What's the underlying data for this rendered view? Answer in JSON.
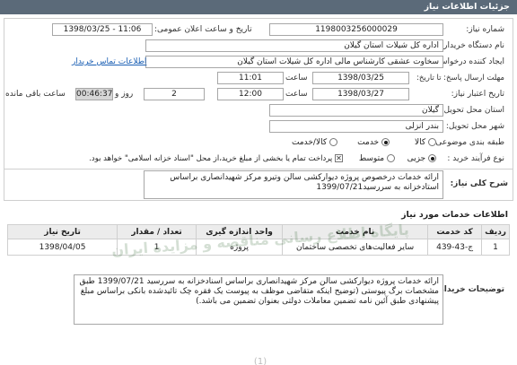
{
  "header": {
    "title": "جزئیات اطلاعات نیاز"
  },
  "fields": {
    "need_number_label": "شماره نیاز:",
    "need_number": "1198003256000029",
    "announce_label": "تاریخ و ساعت اعلان عمومی:",
    "announce_value": "1398/03/25 - 11:06",
    "buyer_label": "نام دستگاه خریدار:",
    "buyer_value": "اداره کل شیلات استان گیلان",
    "creator_label": "ایجاد کننده درخواست:",
    "creator_value": "سخاوت  عشقی  کارشناس مالی  اداره کل شیلات استان گیلان",
    "contact_link": "اطلاعات تماس خریدار",
    "send_deadline_label": "مهلت ارسال پاسخ: تا تاریخ:",
    "send_date": "1398/03/25",
    "time_label": "ساعت",
    "send_time": "11:01",
    "validity_label": "تاریخ اعتبار نیاز:",
    "validity_date": "1398/03/27",
    "validity_time": "12:00",
    "days_value": "2",
    "days_label": "روز و",
    "remaining_time": "00:46:37",
    "remaining_label": "ساعت باقی مانده",
    "province_label": "استان محل تحویل:",
    "province_value": "گیلان",
    "city_label": "شهر محل تحویل:",
    "city_value": "بندر انزلی",
    "category_label": "طبقه بندی موضوعی:",
    "category_options": [
      "کالا",
      "خدمت",
      "کالا/خدمت"
    ],
    "process_label": "نوع فرآیند خرید :",
    "process_options": [
      "جزیی",
      "متوسط"
    ],
    "process_note": "پرداخت تمام یا بخشی از مبلغ خرید،از محل \"اسناد خزانه اسلامی\" خواهد بود."
  },
  "general_desc": {
    "label": "شرح کلی نیاز:",
    "text": "ارائه خدمات درخصوص پروژه دیوارکشی سالن وتیرو مرکز شهیدانصاری براساس استادخزانه به سررسید1399/07/21"
  },
  "services": {
    "title": "اطلاعات خدمات مورد نیاز",
    "columns": [
      "ردیف",
      "کد خدمت",
      "نام خدمت",
      "واحد اندازه گیری",
      "تعداد / مقدار",
      "تاریخ نیاز"
    ],
    "rows": [
      [
        "1",
        "ج-43-439",
        "سایر فعالیت‌های تخصصی ساختمان",
        "پروژه",
        "1",
        "1398/04/05"
      ]
    ]
  },
  "buyer_notes": {
    "label": "توضیحات خریدار:",
    "text": "ارائه خدمات پروژه دیوارکشی سالن  مرکز شهیدانصاری براساس اسنادخزانه به سررسید 1399/07/21 طبق مشخصات برگ پیوستی (توضیح اینکه متقاضی موظف به پیوست یک فقره چک تائیدشده بانکی براساس مبلغ پیشنهادی طبق آئین نامه تضمین معاملات دولتی بعنوان تضمین می باشد.)"
  },
  "watermark": {
    "text": "پایگاه اطلاع رسانی مناقصه و مزایده ایران"
  },
  "footer_fragment": {
    "text": "(1)"
  }
}
